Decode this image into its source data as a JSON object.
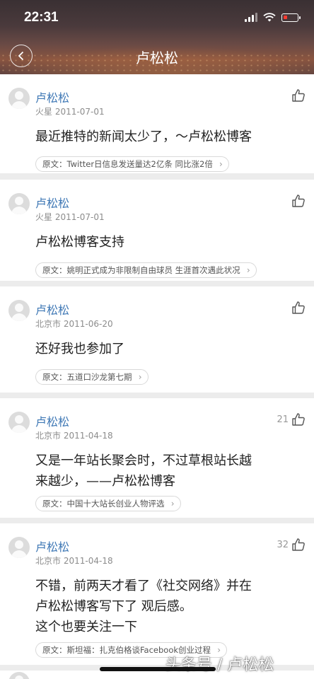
{
  "status": {
    "time": "22:31"
  },
  "nav": {
    "title": "卢松松"
  },
  "posts": [
    {
      "author": "卢松松",
      "location": "火星",
      "date": "2011-07-01",
      "likes": "",
      "lines": [
        "最近推特的新闻太少了，～卢松松博客"
      ],
      "quote": "原文：Twitter日信息发送量达2亿条 同比涨2倍"
    },
    {
      "author": "卢松松",
      "location": "火星",
      "date": "2011-07-01",
      "likes": "",
      "lines": [
        "卢松松博客支持"
      ],
      "quote": "原文：姚明正式成为非限制自由球员 生涯首次遇此状况"
    },
    {
      "author": "卢松松",
      "location": "北京市",
      "date": "2011-06-20",
      "likes": "",
      "lines": [
        "还好我也参加了"
      ],
      "quote": "原文：五道口沙龙第七期"
    },
    {
      "author": "卢松松",
      "location": "北京市",
      "date": "2011-04-18",
      "likes": "21",
      "lines": [
        "又是一年站长聚会时，不过草根站长越",
        "来越少，——卢松松博客"
      ],
      "quote": "原文：中国十大站长创业人物评选"
    },
    {
      "author": "卢松松",
      "location": "北京市",
      "date": "2011-04-18",
      "likes": "32",
      "lines": [
        "不错，前两天才看了《社交网络》并在",
        "卢松松博客写下了 观后感。",
        "这个也要关注一下"
      ],
      "quote": "原文：斯坦福：扎克伯格谈Facebook创业过程"
    }
  ],
  "watermark": "头条号 / 卢松松",
  "icons": {
    "back": "back-arrow-icon",
    "like": "thumbs-up-icon",
    "avatar": "default-avatar-icon"
  }
}
